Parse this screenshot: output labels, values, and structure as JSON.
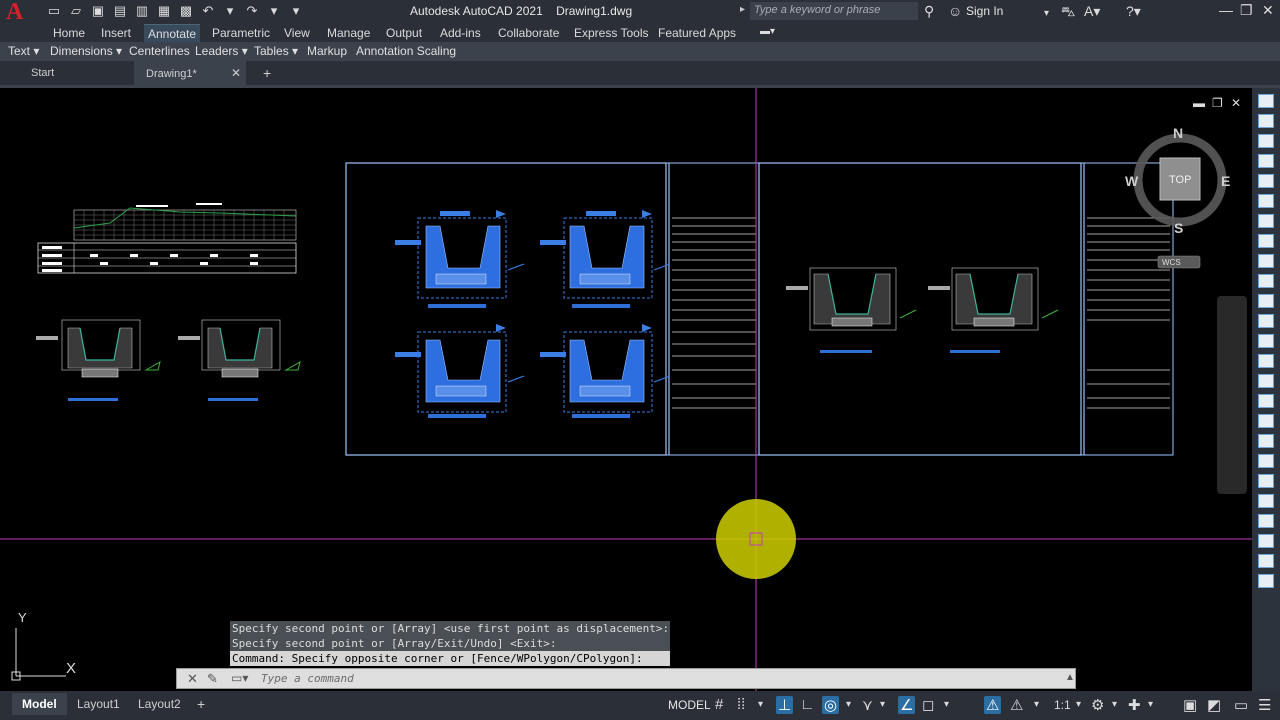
{
  "app": {
    "logo": "A",
    "title": "Autodesk AutoCAD 2021    Drawing1.dwg"
  },
  "titlebar": {
    "search_placeholder": "Type a keyword or phrase",
    "sign_in": "Sign In"
  },
  "menu": [
    "Home",
    "Insert",
    "Annotate",
    "Parametric",
    "View",
    "Manage",
    "Output",
    "Add-ins",
    "Collaborate",
    "Express Tools",
    "Featured Apps"
  ],
  "active_menu": "Annotate",
  "panels": [
    "Text ▾",
    "Dimensions ▾",
    "Centerlines",
    "Leaders ▾",
    "Tables ▾",
    "Markup",
    "Annotation Scaling"
  ],
  "tabs": {
    "start": "Start",
    "drawing": "Drawing1*",
    "close": "✕",
    "new": "+"
  },
  "viewcube": {
    "north": "N",
    "south": "S",
    "east": "E",
    "west": "W",
    "face": "TOP",
    "wcs": "WCS"
  },
  "ucs": {
    "x": "X",
    "y": "Y"
  },
  "command": {
    "history": [
      "Specify second point or [Array] <use first point as displacement>:",
      "Specify second point or [Array/Exit/Undo] <Exit>:",
      "Command: Specify opposite corner or [Fence/WPolygon/CPolygon]:"
    ],
    "placeholder": "Type a command"
  },
  "layouts": [
    "Model",
    "Layout1",
    "Layout2",
    "+"
  ],
  "status": {
    "model": "MODEL",
    "scale": "1:1"
  },
  "colors": {
    "canvas": "#000000",
    "drawing_blue": "#3a7fe6",
    "frame": "#9ec5ff",
    "crosshair": "#c040c0",
    "cursor_halo": "#d4d400"
  }
}
